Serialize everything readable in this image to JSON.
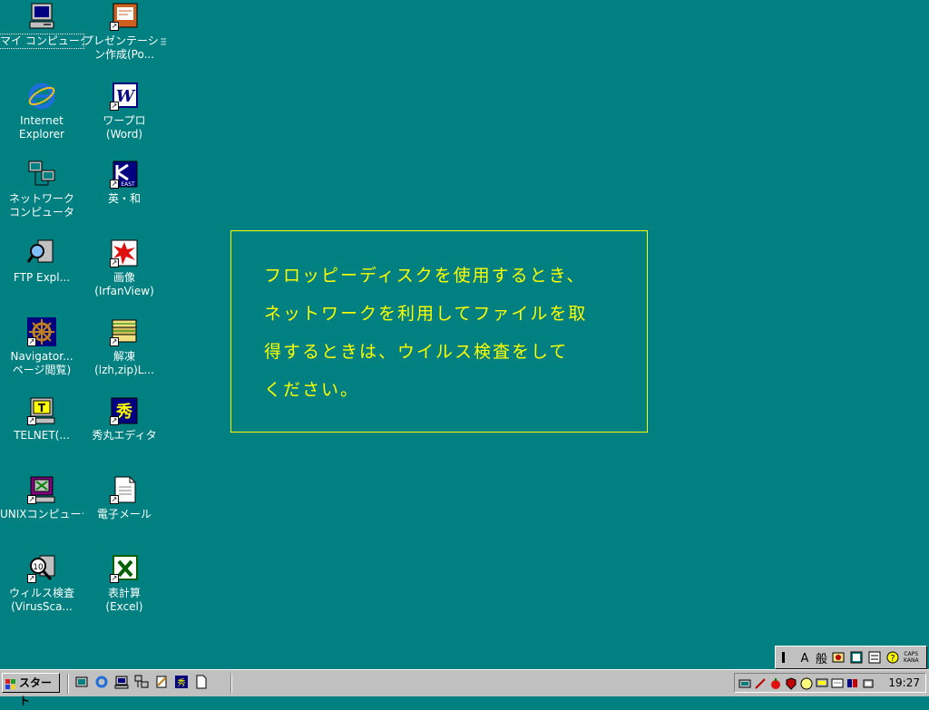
{
  "desktop": {
    "icons": [
      {
        "id": "my-computer",
        "label": "マイ コンピュータ",
        "selected": true
      },
      {
        "id": "internet-explorer",
        "label1": "Internet",
        "label2": "Explorer"
      },
      {
        "id": "network-computer",
        "label1": "ネットワーク",
        "label2": "コンピュータ"
      },
      {
        "id": "ftp-explorer",
        "label": "FTP  Expl..."
      },
      {
        "id": "navigator",
        "label1": "Navigator...",
        "label2": "ページ閲覧)"
      },
      {
        "id": "telnet",
        "label": "TELNET(..."
      },
      {
        "id": "unix-computer",
        "label": "UNIXコンピュータ"
      },
      {
        "id": "virus-scan",
        "label1": "ウィルス検査",
        "label2": "(VirusSca..."
      },
      {
        "id": "powerpoint",
        "label1": "プレゼンテーショ",
        "label2": "ン作成(Po..."
      },
      {
        "id": "word",
        "label1": "ワープロ",
        "label2": "(Word)"
      },
      {
        "id": "dictionary",
        "label": "英・和"
      },
      {
        "id": "irfanview",
        "label1": "画像",
        "label2": "(IrfanView)"
      },
      {
        "id": "unzip",
        "label1": "解凍",
        "label2": "(lzh,zip)L..."
      },
      {
        "id": "hidemaru",
        "label": "秀丸エディタ"
      },
      {
        "id": "email",
        "label": "電子メール"
      },
      {
        "id": "excel",
        "label1": "表計算",
        "label2": "(Excel)"
      }
    ]
  },
  "notice": {
    "line1": "フロッピーディスクを使用するとき、",
    "line2": "ネットワークを利用してファイルを取",
    "line3": "得するときは、ウイルス検査をして",
    "line4": "ください。"
  },
  "taskbar": {
    "start_label": "スタート",
    "clock": "19:27"
  },
  "ime": {
    "mode_label": "般",
    "caps1": "CAPS",
    "caps2": "KANA"
  },
  "colors": {
    "desktop": "#008080",
    "notice_text": "#ffff00",
    "taskbar": "#c0c0c0"
  }
}
